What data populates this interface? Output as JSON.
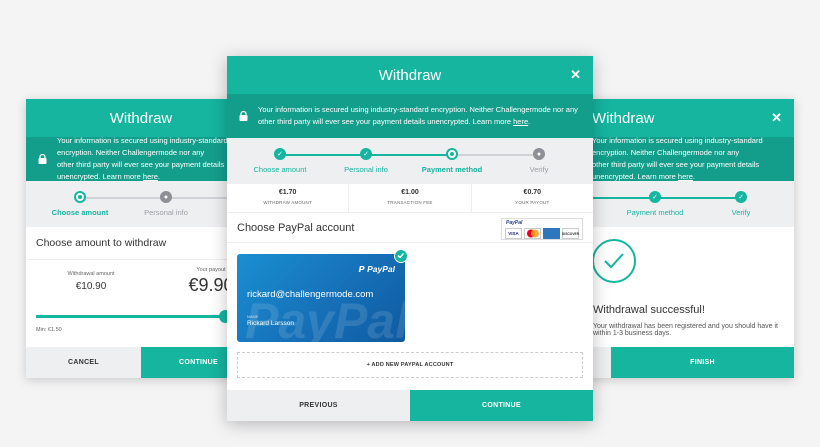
{
  "left": {
    "header_title": "Withdraw",
    "notice_line1": "Your information is secured using industry-standard encryption. Neither Challengermode nor any",
    "notice_line2": "other third party will ever see your payment details unencrypted. Learn more",
    "notice_link": "here",
    "steps": [
      "Choose amount",
      "Personal info"
    ],
    "section_title": "Choose amount to withdraw",
    "withdrawal_label": "Withdrawal amount",
    "withdrawal_value": "€10.90",
    "payout_label": "Your payout",
    "payout_value": "€9.90",
    "slider_fraction": 0.9,
    "min_label": "Min: €1.50",
    "cancel_label": "CANCEL",
    "continue_label": "CONTINUE"
  },
  "center": {
    "header_title": "Withdraw",
    "notice_line1": "Your information is secured using industry-standard encryption. Neither Challengermode nor any",
    "notice_line2": "other third party will ever see your payment details unencrypted. Learn more",
    "notice_link": "here",
    "steps": [
      {
        "label": "Choose amount",
        "state": "done"
      },
      {
        "label": "Personal info",
        "state": "done"
      },
      {
        "label": "Payment method",
        "state": "current"
      },
      {
        "label": "Verify",
        "state": "todo"
      }
    ],
    "summary": [
      {
        "value": "€1.70",
        "label": "WITHDRAW AMOUNT"
      },
      {
        "value": "€1.00",
        "label": "TRANSACTION FEE"
      },
      {
        "value": "€0.70",
        "label": "YOUR PAYOUT"
      }
    ],
    "paypal_title": "Choose PayPal account",
    "badge_brand": "PayPal",
    "card_logos": [
      "VISA",
      "MC",
      "AMEX",
      "DISCOVER"
    ],
    "account_brand": "PayPal",
    "account_watermark": "PayPal",
    "account_email": "rickard@challengermode.com",
    "account_name_label": "NAME",
    "account_name": "Rickard Larsson",
    "add_account_label": "+ ADD NEW PAYPAL ACCOUNT",
    "previous_label": "PREVIOUS",
    "continue_label": "CONTINUE"
  },
  "right": {
    "header_title": "Withdraw",
    "notice_line1": "Your information is secured using industry-standard encryption. Neither Challengermode nor any",
    "notice_line2": "other third party will ever see your payment details unencrypted. Learn more",
    "notice_link": "here",
    "steps": [
      "Payment method",
      "Verify"
    ],
    "success_title": "Withdrawal successful!",
    "success_sub": "Your withdrawal has been registered and you should have it within 1-3 business days.",
    "finish_label": "FINISH"
  },
  "colors": {
    "accent": "#15b5a0",
    "accent_dark": "#139e8b",
    "paypal_blue": "#1670b8"
  }
}
